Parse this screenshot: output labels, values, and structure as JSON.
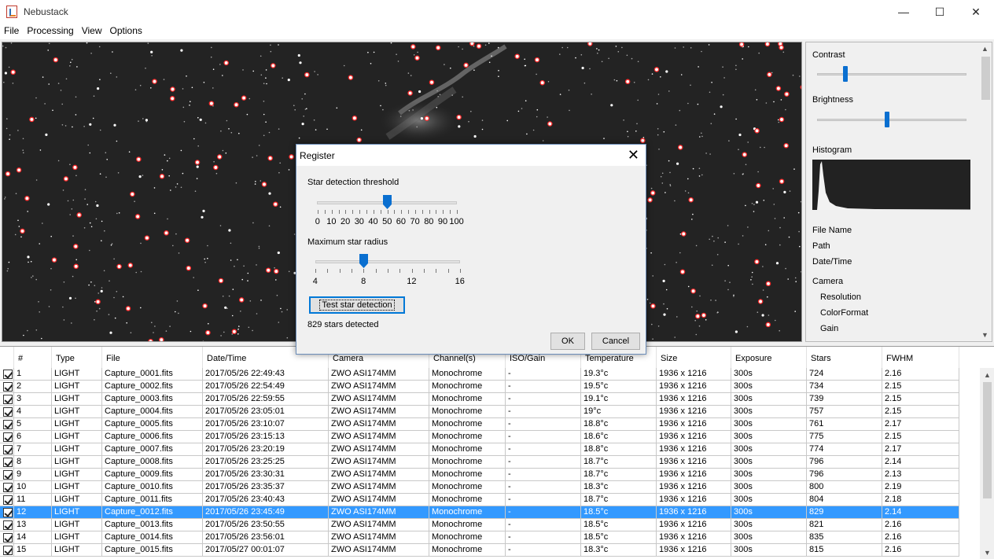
{
  "app": {
    "title": "Nebustack"
  },
  "window_controls": {
    "minimize": "—",
    "maximize": "☐",
    "close": "✕"
  },
  "menu": [
    "File",
    "Processing",
    "View",
    "Options"
  ],
  "side_panel": {
    "contrast_label": "Contrast",
    "contrast_level": 0.19,
    "brightness_label": "Brightness",
    "brightness_level": 0.47,
    "histogram_label": "Histogram",
    "info": [
      "File Name",
      "Path",
      "Date/Time"
    ],
    "camera_label": "Camera",
    "camera_items": [
      "Resolution",
      "ColorFormat",
      "Gain"
    ]
  },
  "dialog": {
    "title": "Register",
    "close_glyph": "✕",
    "threshold_label": "Star detection threshold",
    "threshold_value": 50,
    "threshold_ticks": [
      "0",
      "10",
      "20",
      "30",
      "40",
      "50",
      "60",
      "70",
      "80",
      "90",
      "100"
    ],
    "radius_label": "Maximum star radius",
    "radius_value": 8,
    "radius_ticks": [
      "4",
      "8",
      "12",
      "16"
    ],
    "test_button": "Test star detection",
    "status": "829 stars detected",
    "ok": "OK",
    "cancel": "Cancel"
  },
  "table": {
    "columns": [
      "#",
      "Type",
      "File",
      "Date/Time",
      "Camera",
      "Channel(s)",
      "ISO/Gain",
      "Temperature",
      "Size",
      "Exposure",
      "Stars",
      "FWHM"
    ],
    "selected_row": 12,
    "rows": [
      [
        "1",
        "LIGHT",
        "Capture_0001.fits",
        "2017/05/26 22:49:43",
        "ZWO ASI174MM",
        "Monochrome",
        "-",
        "19.3°c",
        "1936 x 1216",
        "300s",
        "724",
        "2.16"
      ],
      [
        "2",
        "LIGHT",
        "Capture_0002.fits",
        "2017/05/26 22:54:49",
        "ZWO ASI174MM",
        "Monochrome",
        "-",
        "19.5°c",
        "1936 x 1216",
        "300s",
        "734",
        "2.15"
      ],
      [
        "3",
        "LIGHT",
        "Capture_0003.fits",
        "2017/05/26 22:59:55",
        "ZWO ASI174MM",
        "Monochrome",
        "-",
        "19.1°c",
        "1936 x 1216",
        "300s",
        "739",
        "2.15"
      ],
      [
        "4",
        "LIGHT",
        "Capture_0004.fits",
        "2017/05/26 23:05:01",
        "ZWO ASI174MM",
        "Monochrome",
        "-",
        "19°c",
        "1936 x 1216",
        "300s",
        "757",
        "2.15"
      ],
      [
        "5",
        "LIGHT",
        "Capture_0005.fits",
        "2017/05/26 23:10:07",
        "ZWO ASI174MM",
        "Monochrome",
        "-",
        "18.8°c",
        "1936 x 1216",
        "300s",
        "761",
        "2.17"
      ],
      [
        "6",
        "LIGHT",
        "Capture_0006.fits",
        "2017/05/26 23:15:13",
        "ZWO ASI174MM",
        "Monochrome",
        "-",
        "18.6°c",
        "1936 x 1216",
        "300s",
        "775",
        "2.15"
      ],
      [
        "7",
        "LIGHT",
        "Capture_0007.fits",
        "2017/05/26 23:20:19",
        "ZWO ASI174MM",
        "Monochrome",
        "-",
        "18.8°c",
        "1936 x 1216",
        "300s",
        "774",
        "2.17"
      ],
      [
        "8",
        "LIGHT",
        "Capture_0008.fits",
        "2017/05/26 23:25:25",
        "ZWO ASI174MM",
        "Monochrome",
        "-",
        "18.7°c",
        "1936 x 1216",
        "300s",
        "796",
        "2.14"
      ],
      [
        "9",
        "LIGHT",
        "Capture_0009.fits",
        "2017/05/26 23:30:31",
        "ZWO ASI174MM",
        "Monochrome",
        "-",
        "18.7°c",
        "1936 x 1216",
        "300s",
        "796",
        "2.13"
      ],
      [
        "10",
        "LIGHT",
        "Capture_0010.fits",
        "2017/05/26 23:35:37",
        "ZWO ASI174MM",
        "Monochrome",
        "-",
        "18.3°c",
        "1936 x 1216",
        "300s",
        "800",
        "2.19"
      ],
      [
        "11",
        "LIGHT",
        "Capture_0011.fits",
        "2017/05/26 23:40:43",
        "ZWO ASI174MM",
        "Monochrome",
        "-",
        "18.7°c",
        "1936 x 1216",
        "300s",
        "804",
        "2.18"
      ],
      [
        "12",
        "LIGHT",
        "Capture_0012.fits",
        "2017/05/26 23:45:49",
        "ZWO ASI174MM",
        "Monochrome",
        "-",
        "18.5°c",
        "1936 x 1216",
        "300s",
        "829",
        "2.14"
      ],
      [
        "13",
        "LIGHT",
        "Capture_0013.fits",
        "2017/05/26 23:50:55",
        "ZWO ASI174MM",
        "Monochrome",
        "-",
        "18.5°c",
        "1936 x 1216",
        "300s",
        "821",
        "2.16"
      ],
      [
        "14",
        "LIGHT",
        "Capture_0014.fits",
        "2017/05/26 23:56:01",
        "ZWO ASI174MM",
        "Monochrome",
        "-",
        "18.5°c",
        "1936 x 1216",
        "300s",
        "835",
        "2.16"
      ],
      [
        "15",
        "LIGHT",
        "Capture_0015.fits",
        "2017/05/27 00:01:07",
        "ZWO ASI174MM",
        "Monochrome",
        "-",
        "18.3°c",
        "1936 x 1216",
        "300s",
        "815",
        "2.16"
      ]
    ]
  },
  "colors": {
    "accent": "#0a6fd0",
    "selection": "#3399ff",
    "star_marker": "#ff2a2a"
  }
}
